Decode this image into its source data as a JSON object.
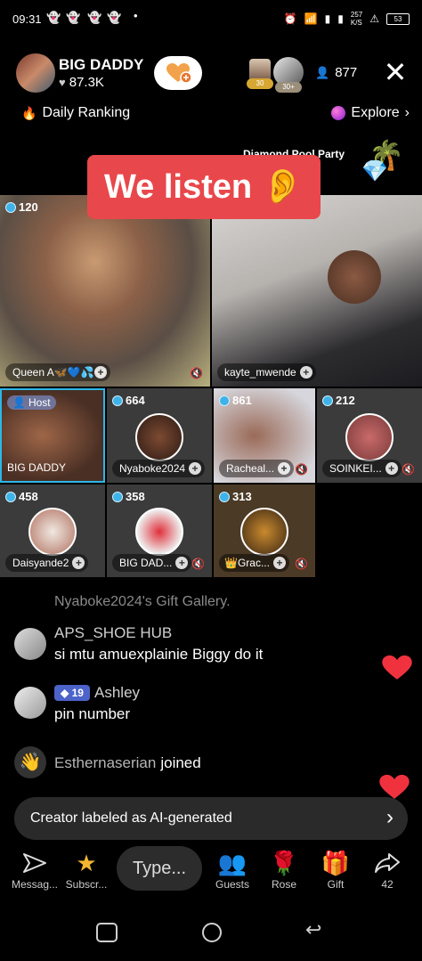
{
  "status_bar": {
    "time": "09:31",
    "speed": "257\nK/S",
    "battery": "53"
  },
  "host": {
    "name": "BIG DADDY",
    "likes": "87.3K"
  },
  "viewers": {
    "badge1": "30",
    "badge2": "30+",
    "count": "877"
  },
  "ranking": {
    "label": "Daily Ranking"
  },
  "explore": {
    "label": "Explore"
  },
  "event": {
    "label": "Diamond Pool Party"
  },
  "banner": {
    "text": "We listen"
  },
  "tiles": [
    {
      "count": "120",
      "name": "Queen A🦋💙💦🦋"
    },
    {
      "name": "kayte_mwende"
    },
    {
      "host_label": "Host",
      "name": "BIG DADDY"
    },
    {
      "count": "664",
      "name": "Nyaboke2024"
    },
    {
      "count": "861",
      "name": "Racheal..."
    },
    {
      "count": "212",
      "name": "SOINKEI..."
    },
    {
      "count": "458",
      "name": "Daisyande2"
    },
    {
      "count": "358",
      "name": "BIG DAD..."
    },
    {
      "count": "313",
      "name": "Grac..."
    }
  ],
  "chat": {
    "gift_gallery": "Nyaboke2024's Gift Gallery.",
    "messages": [
      {
        "user": "APS_SHOE HUB",
        "text": "si mtu amuexplainie Biggy do it"
      },
      {
        "level": "19",
        "user": "Ashley",
        "text": "pin number"
      }
    ],
    "join": {
      "user": "Esthernaserian",
      "action": "joined"
    }
  },
  "ai_notice": "Creator labeled as AI-generated",
  "bottom_bar": {
    "messages": "Messag...",
    "subscribe": "Subscr...",
    "type_placeholder": "Type...",
    "guests": "Guests",
    "rose": "Rose",
    "gift": "Gift",
    "share_count": "42"
  },
  "icons": [
    "snapchat-icon",
    "alarm-icon",
    "wifi-icon",
    "signal-icon",
    "heart-icon",
    "person-icon",
    "close-icon",
    "flame-icon",
    "chevron-right-icon",
    "palm-tree-icon",
    "diamond-icon",
    "ear-icon",
    "eye-icon",
    "plus-icon",
    "mic-off-icon",
    "crown-icon",
    "wave-icon",
    "paper-plane-icon",
    "star-icon",
    "guests-icon",
    "rose-icon",
    "gift-icon",
    "share-icon",
    "back-icon",
    "home-icon",
    "recents-icon"
  ]
}
